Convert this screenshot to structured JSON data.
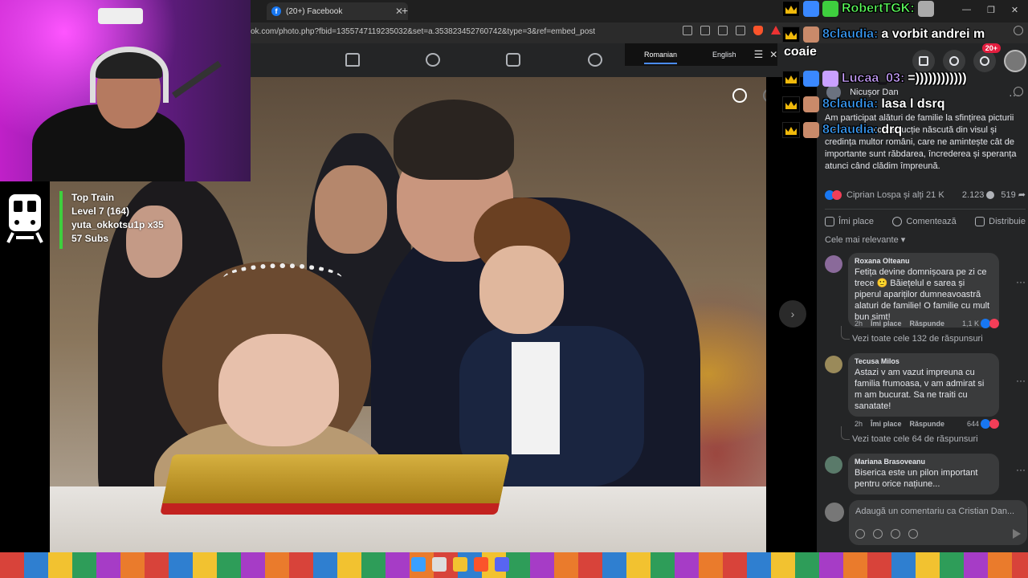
{
  "browser": {
    "tab_title": "(20+) Facebook",
    "tab_favicon": "f",
    "url": "ok.com/photo.php?fbid=1355747119235032&set=a.353823452760742&type=3&ref=embed_post"
  },
  "translate_bar": {
    "lang_from": "Romanian",
    "lang_to": "English"
  },
  "fb_header": {
    "notifications_badge": "20+"
  },
  "stream_overlay": {
    "train_title": "Top Train",
    "train_level": "Level 7  (164)",
    "train_contributor": "yuta_okkotsu1p x35",
    "train_subs": "57 Subs"
  },
  "chat": [
    {
      "user": "RobertTGK:",
      "message": "",
      "color": "#5cff5c"
    },
    {
      "user": "8claudia:",
      "message": "a vorbit andrei m",
      "color": "#3aa0ff"
    },
    {
      "user": "",
      "message": "coaie",
      "color": "#ffffff"
    },
    {
      "user": "Lucaa_03:",
      "message": "=))))))))))))",
      "color": "#c9a0ff"
    },
    {
      "user": "8claudia:",
      "message": "lasa l dsrq",
      "color": "#3aa0ff"
    },
    {
      "user": "8claudia:",
      "message": "drq",
      "color": "#3aa0ff"
    }
  ],
  "post": {
    "author": "Nicușor Dan",
    "text": "Am participat alături de familie la sfințirea picturii Catedralei, o construcție născută din visul și credința multor români, care ne amintește cât de importante sunt răbdarea, încrederea și speranța atunci când clădim împreună.",
    "reactions_text": "Ciprian Lospa și alți 21 K",
    "comment_count": "2.123",
    "share_count": "519",
    "like_label": "Îmi place",
    "comment_label": "Comentează",
    "share_label": "Distribuie",
    "sort_label": "Cele mai relevante"
  },
  "comments": [
    {
      "name": "Roxana Olteanu",
      "text": "Fetița devine domnișoara pe zi ce trece 🙂 Băiețelul e sarea și piperul apariților dumneavoastră alaturi de familie! O familie cu mult bun simt!",
      "time": "2h",
      "like": "Îmi place",
      "reply": "Răspunde",
      "likes": "1,1 K",
      "replies": "Vezi toate cele 132 de răspunsuri"
    },
    {
      "name": "Tecusa Milos",
      "text": "Astazi v am vazut impreuna cu familia frumoasa, v am admirat si m am bucurat. Sa ne traiti cu sanatate!",
      "time": "2h",
      "like": "Îmi place",
      "reply": "Răspunde",
      "likes": "644",
      "replies": "Vezi toate cele 64 de răspunsuri"
    },
    {
      "name": "Mariana Brasoveanu",
      "text": "Biserica este un pilon important pentru orice națiune...",
      "time": "",
      "like": "",
      "reply": "",
      "likes": "",
      "replies": ""
    }
  ],
  "composer": {
    "placeholder": "Adaugă un comentariu ca Cristian Dan..."
  },
  "colors": {
    "fb_blue": "#1877f2",
    "fb_dark": "#242526",
    "train_green": "#3ecf3e",
    "chat_crown": "#f0b90b"
  }
}
